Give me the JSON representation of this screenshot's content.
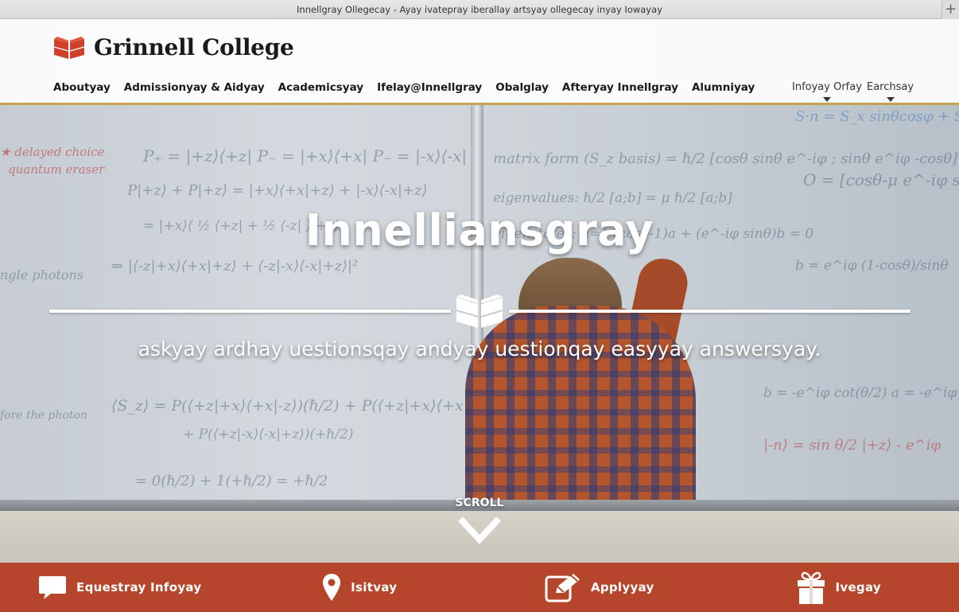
{
  "browser": {
    "tab_title": "Innellgray Ollegecay - Ayay ivatepray iberallay artsyay ollegecay inyay Iowayay",
    "new_tab": "+"
  },
  "header": {
    "logo_text": "Grinnell College",
    "nav": [
      "Aboutyay",
      "Admissionyay & Aidyay",
      "Academicsyay",
      "Ifelay@Innellgray",
      "Obalglay",
      "Afteryay Innellgray",
      "Alumniyay"
    ],
    "utility": {
      "info_for": "Infoyay Orfay",
      "search": "Earchsay"
    }
  },
  "hero": {
    "title": "Innelliansgray",
    "subtitle": "askyay ardhay uestionsqay andyay uestionqay easyyay answersyay.",
    "scroll_label": "SCROLL"
  },
  "actions": [
    {
      "label": "Equestray Infoyay",
      "icon": "speech-bubble-icon"
    },
    {
      "label": "Isitvay",
      "icon": "map-pin-icon"
    },
    {
      "label": "Applyyay",
      "icon": "edit-pencil-icon"
    },
    {
      "label": "Ivegay",
      "icon": "gift-icon"
    }
  ],
  "colors": {
    "brand_red": "#b5462b",
    "logo_red": "#d0412c",
    "header_rule": "#c8a34e"
  }
}
